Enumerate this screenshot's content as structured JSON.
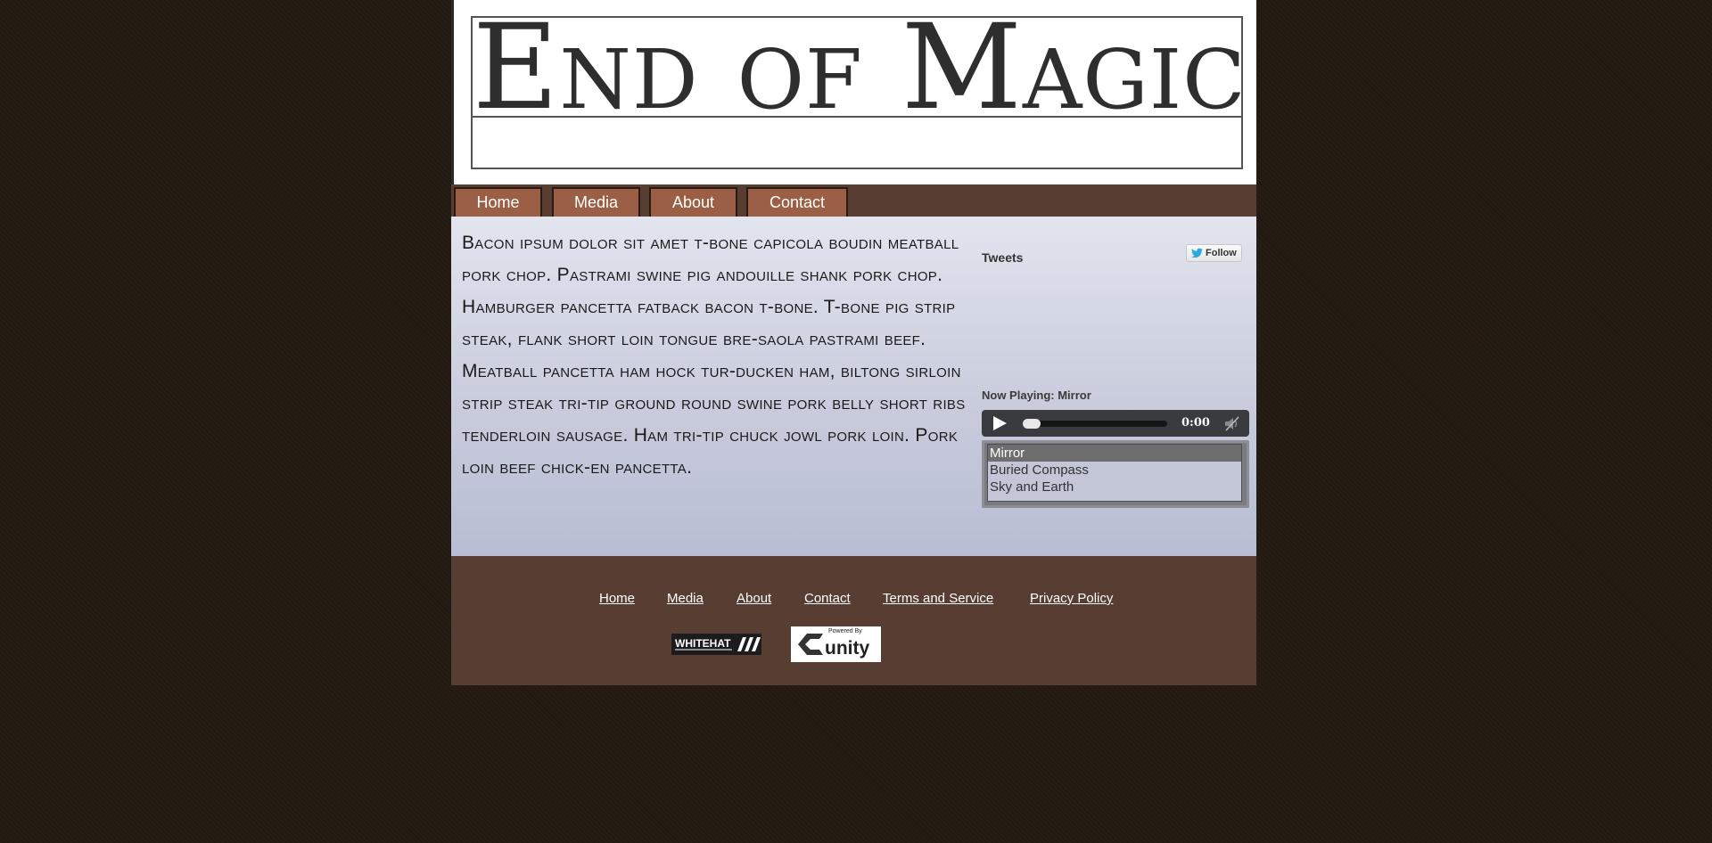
{
  "header": {
    "logo_text": "End of Magic"
  },
  "nav": {
    "items": [
      {
        "label": "Home"
      },
      {
        "label": "Media"
      },
      {
        "label": "About"
      },
      {
        "label": "Contact"
      }
    ]
  },
  "main": {
    "body_text": "Bacon ipsum dolor sit amet t-bone capicola boudin meatball pork chop. Pastrami swine pig andouille shank pork chop. Hamburger pancetta fatback bacon t-bone. T-bone pig strip steak, flank short loin tongue bre-saola pastrami beef. Meatball pancetta ham hock tur-ducken ham, biltong sirloin strip steak tri-tip ground round swine pork belly short ribs tenderloin sausage. Ham tri-tip chuck jowl pork loin. Pork loin beef chick-en pancetta."
  },
  "sidebar": {
    "tweets_title": "Tweets",
    "follow_label": "Follow",
    "now_playing": "Now Playing: Mirror",
    "player": {
      "time": "0:00",
      "progress": 0
    },
    "playlist": [
      {
        "title": "Mirror",
        "active": true
      },
      {
        "title": "Buried Compass",
        "active": false
      },
      {
        "title": "Sky and Earth",
        "active": false
      }
    ]
  },
  "footer": {
    "links": [
      {
        "label": "Home"
      },
      {
        "label": "Media"
      },
      {
        "label": "About"
      },
      {
        "label": "Contact"
      },
      {
        "label": "Terms and Service"
      },
      {
        "label": "Privacy Policy"
      }
    ],
    "badges": {
      "whitehat": "WHITEHAT",
      "unity_powered": "Powered By",
      "unity": "unity"
    }
  },
  "icons": {
    "twitter": "twitter-bird-icon",
    "play": "play-icon",
    "mute": "mute-icon"
  },
  "colors": {
    "background": "#231a12",
    "nav_bar": "#573d32",
    "nav_button": "#9a5f44",
    "footer": "#573d32",
    "twitter_blue": "#2aa9e0"
  }
}
